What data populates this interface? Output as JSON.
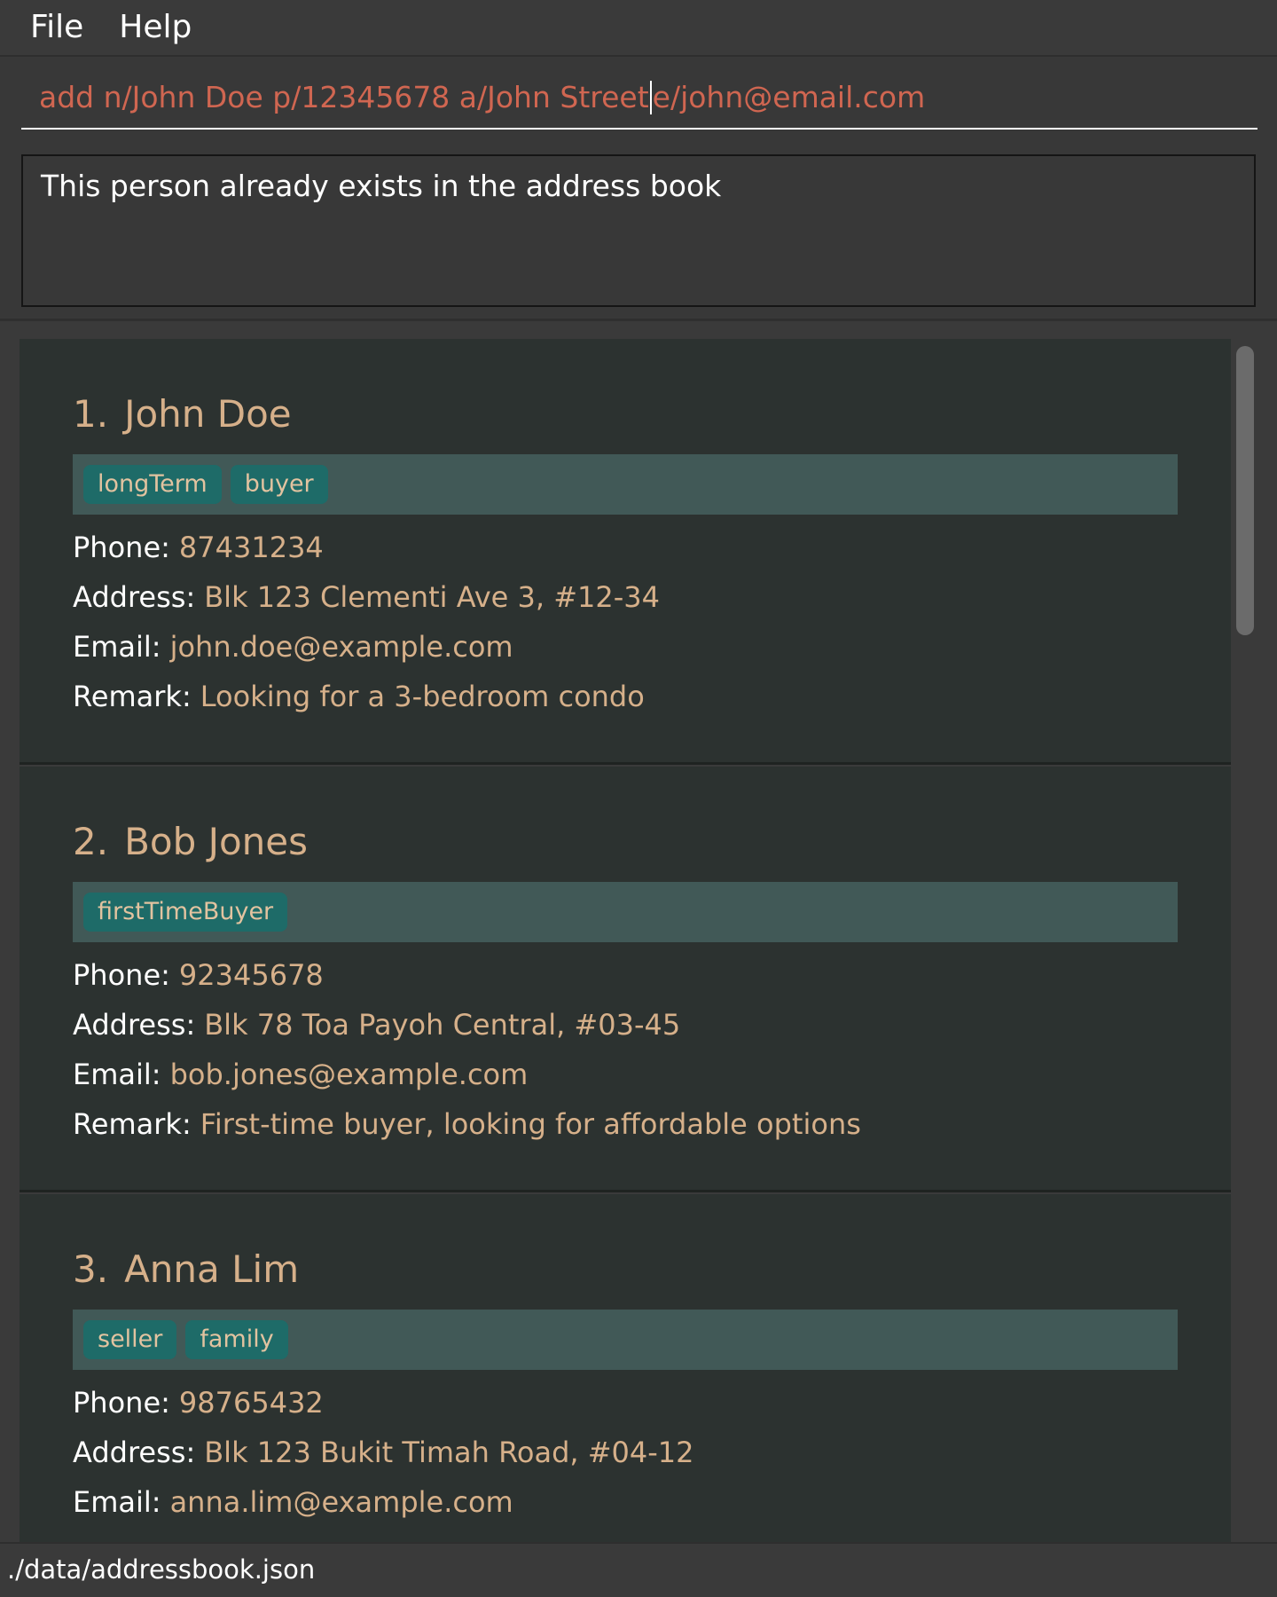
{
  "menu": {
    "file_label": "File",
    "help_label": "Help"
  },
  "command": {
    "before_caret": "add n/John Doe p/12345678 a/John Street",
    "after_caret": "e/john@email.com"
  },
  "result": {
    "message": "This person already exists in the address book"
  },
  "field_labels": {
    "phone": "Phone:",
    "address": "Address:",
    "email": "Email:",
    "remark": "Remark:"
  },
  "persons": [
    {
      "index": "1.",
      "name": "John Doe",
      "tags": [
        "longTerm",
        "buyer"
      ],
      "phone": "87431234",
      "address": "Blk 123 Clementi Ave 3, #12-34",
      "email": "john.doe@example.com",
      "remark": "Looking for a 3-bedroom condo"
    },
    {
      "index": "2.",
      "name": "Bob Jones",
      "tags": [
        "firstTimeBuyer"
      ],
      "phone": "92345678",
      "address": "Blk 78 Toa Payoh Central, #03-45",
      "email": "bob.jones@example.com",
      "remark": "First-time buyer, looking for affordable options"
    },
    {
      "index": "3.",
      "name": "Anna Lim",
      "tags": [
        "seller",
        "family"
      ],
      "phone": "98765432",
      "address": "Blk 123 Bukit Timah Road, #04-12",
      "email": "anna.lim@example.com"
    }
  ],
  "status": {
    "file_path": "./data/addressbook.json"
  },
  "colors": {
    "accent_value": "#d6b08a",
    "command_text": "#d06651",
    "tag_bg": "#1e6b68",
    "card_bg": "#2c3230"
  }
}
